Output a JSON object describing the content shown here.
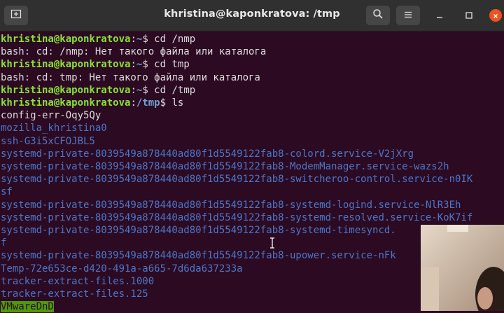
{
  "window": {
    "title": "khristina@kaponkratova: /tmp"
  },
  "prompt": {
    "user_host": "khristina@kaponkratova",
    "sep": ":"
  },
  "terminal": {
    "lines": [
      {
        "type": "prompt",
        "dir": "~",
        "cmd": "$ cd /nmp"
      },
      {
        "type": "output",
        "text": "bash: cd: /nmp: Нет такого файла или каталога"
      },
      {
        "type": "prompt",
        "dir": "~",
        "cmd": "$ cd tmp"
      },
      {
        "type": "output",
        "text": "bash: cd: tmp: Нет такого файла или каталога"
      },
      {
        "type": "prompt",
        "dir": "~",
        "cmd": "$ cd /tmp"
      },
      {
        "type": "prompt",
        "dir": "/tmp",
        "cmd": "$ ls"
      },
      {
        "type": "file",
        "text": "config-err-Oqy5Qy"
      },
      {
        "type": "dir",
        "text": "mozilla_khristina0"
      },
      {
        "type": "dir",
        "text": "ssh-G3i5xCFOJBL5"
      },
      {
        "type": "dir",
        "text": "systemd-private-8039549a878440ad80f1d5549122fab8-colord.service-V2jXrg"
      },
      {
        "type": "dir",
        "text": "systemd-private-8039549a878440ad80f1d5549122fab8-ModemManager.service-wazs2h"
      },
      {
        "type": "dir",
        "text": "systemd-private-8039549a878440ad80f1d5549122fab8-switcheroo-control.service-n0IK"
      },
      {
        "type": "dir",
        "text": "sf"
      },
      {
        "type": "dir",
        "text": "systemd-private-8039549a878440ad80f1d5549122fab8-systemd-logind.service-NlR3Eh"
      },
      {
        "type": "dir",
        "text": "systemd-private-8039549a878440ad80f1d5549122fab8-systemd-resolved.service-KoK7if"
      },
      {
        "type": "dir",
        "text": "systemd-private-8039549a878440ad80f1d5549122fab8-systemd-timesyncd."
      },
      {
        "type": "dir",
        "text": "f"
      },
      {
        "type": "dir",
        "text": "systemd-private-8039549a878440ad80f1d5549122fab8-upower.service-nFk"
      },
      {
        "type": "dir",
        "text": "Temp-72e653ce-d420-491a-a665-7d6da637233a"
      },
      {
        "type": "dir",
        "text": "tracker-extract-files.1000"
      },
      {
        "type": "dir",
        "text": "tracker-extract-files.125"
      },
      {
        "type": "hl",
        "text": "VMwareDnD"
      }
    ]
  },
  "icons": {
    "new_tab": "new-tab-icon",
    "search": "search-icon",
    "menu": "hamburger-menu-icon",
    "minimize": "minimize-icon",
    "maximize": "maximize-icon",
    "close": "close-icon",
    "cursor": "text-cursor-icon"
  },
  "colors": {
    "background": "#2c0a22",
    "user": "#8ae234",
    "path": "#729fcf",
    "directory": "#4b77c9",
    "highlight_bg": "#4e9a06",
    "close_button": "#e95420"
  }
}
